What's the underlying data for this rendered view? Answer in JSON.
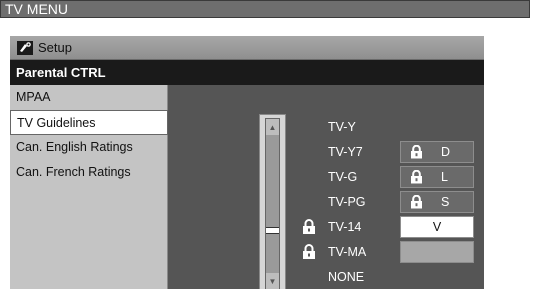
{
  "window": {
    "title": "TV MENU"
  },
  "header": {
    "setup_label": "Setup",
    "icon": "setup-tool-icon"
  },
  "section": {
    "title": "Parental CTRL"
  },
  "sidebar": {
    "items": [
      {
        "label": "MPAA",
        "selected": false
      },
      {
        "label": "TV Guidelines",
        "selected": true
      },
      {
        "label": "Can. English Ratings",
        "selected": false
      },
      {
        "label": "Can. French Ratings",
        "selected": false
      }
    ]
  },
  "ratings": {
    "items": [
      {
        "label": "TV-Y",
        "locked": false
      },
      {
        "label": "TV-Y7",
        "locked": false
      },
      {
        "label": "TV-G",
        "locked": false
      },
      {
        "label": "TV-PG",
        "locked": false
      },
      {
        "label": "TV-14",
        "locked": true
      },
      {
        "label": "TV-MA",
        "locked": true
      },
      {
        "label": "NONE",
        "locked": false
      }
    ]
  },
  "content_flags": {
    "items": [
      {
        "label": "D",
        "locked": true,
        "style": "dark"
      },
      {
        "label": "L",
        "locked": true,
        "style": "dark"
      },
      {
        "label": "S",
        "locked": true,
        "style": "dark"
      },
      {
        "label": "V",
        "locked": false,
        "style": "white"
      },
      {
        "label": "",
        "locked": false,
        "style": "grey"
      }
    ]
  },
  "icons": {
    "lock": "lock-icon",
    "scroll_up": "arrow-up-icon",
    "scroll_down": "arrow-down-icon"
  },
  "colors": {
    "background": "#555555",
    "sidebar": "#c4c4c4",
    "selected": "#ffffff",
    "title_bar": "#6e6e6e"
  }
}
